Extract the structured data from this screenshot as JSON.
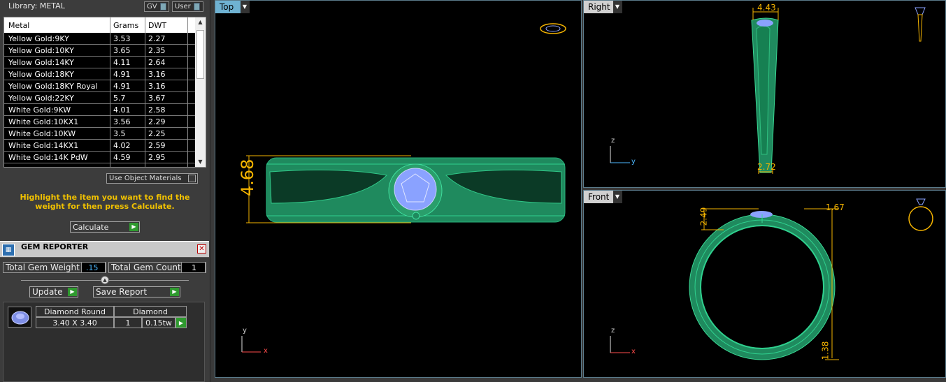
{
  "library": {
    "title": "Library: METAL",
    "gv_label": "GV",
    "user_label": "User"
  },
  "metal_table": {
    "headers": [
      "Metal",
      "Grams",
      "DWT"
    ],
    "rows": [
      [
        "Yellow Gold:9KY",
        "3.53",
        "2.27"
      ],
      [
        "Yellow Gold:10KY",
        "3.65",
        "2.35"
      ],
      [
        "Yellow Gold:14KY",
        "4.11",
        "2.64"
      ],
      [
        "Yellow Gold:18KY",
        "4.91",
        "3.16"
      ],
      [
        "Yellow Gold:18KY Royal",
        "4.91",
        "3.16"
      ],
      [
        "Yellow Gold:22KY",
        "5.7",
        "3.67"
      ],
      [
        "White Gold:9KW",
        "4.01",
        "2.58"
      ],
      [
        "White Gold:10KX1",
        "3.56",
        "2.29"
      ],
      [
        "White Gold:10KW",
        "3.5",
        "2.25"
      ],
      [
        "White Gold:14KX1",
        "4.02",
        "2.59"
      ],
      [
        "White Gold:14K PdW",
        "4.59",
        "2.95"
      ]
    ]
  },
  "use_object_materials": "Use Object Materials",
  "hint": "Highlight the item you want to find the weight for then press Calculate.",
  "calculate_label": "Calculate",
  "gem_reporter": {
    "title": "GEM REPORTER",
    "total_weight_label": "Total Gem Weight",
    "total_weight_value": ".15",
    "total_count_label": "Total Gem Count",
    "total_count_value": "1",
    "update_label": "Update",
    "save_report_label": "Save Report",
    "gem": {
      "name": "Diamond Round",
      "material": "Diamond",
      "size": "3.40 X 3.40",
      "count": "1",
      "weight": "0.15tw"
    }
  },
  "viewports": {
    "top": {
      "label": "Top",
      "dim_height": "4.68",
      "axis_v": "y",
      "axis_h": "x"
    },
    "right": {
      "label": "Right",
      "dim_top": "4.43",
      "dim_bottom": "2.72",
      "axis_v": "z",
      "axis_h": "y"
    },
    "front": {
      "label": "Front",
      "dim_left": "2.49",
      "dim_right": "1.67",
      "dim_bottom": "1.38",
      "axis_v": "z",
      "axis_h": "x"
    }
  },
  "colors": {
    "ring_green": "#1f8a5e",
    "gem_blue": "#8aa2ff",
    "dim_yellow": "#f5b400",
    "tab_active": "#6fb2d2",
    "hint_yellow": "#f2c200"
  }
}
